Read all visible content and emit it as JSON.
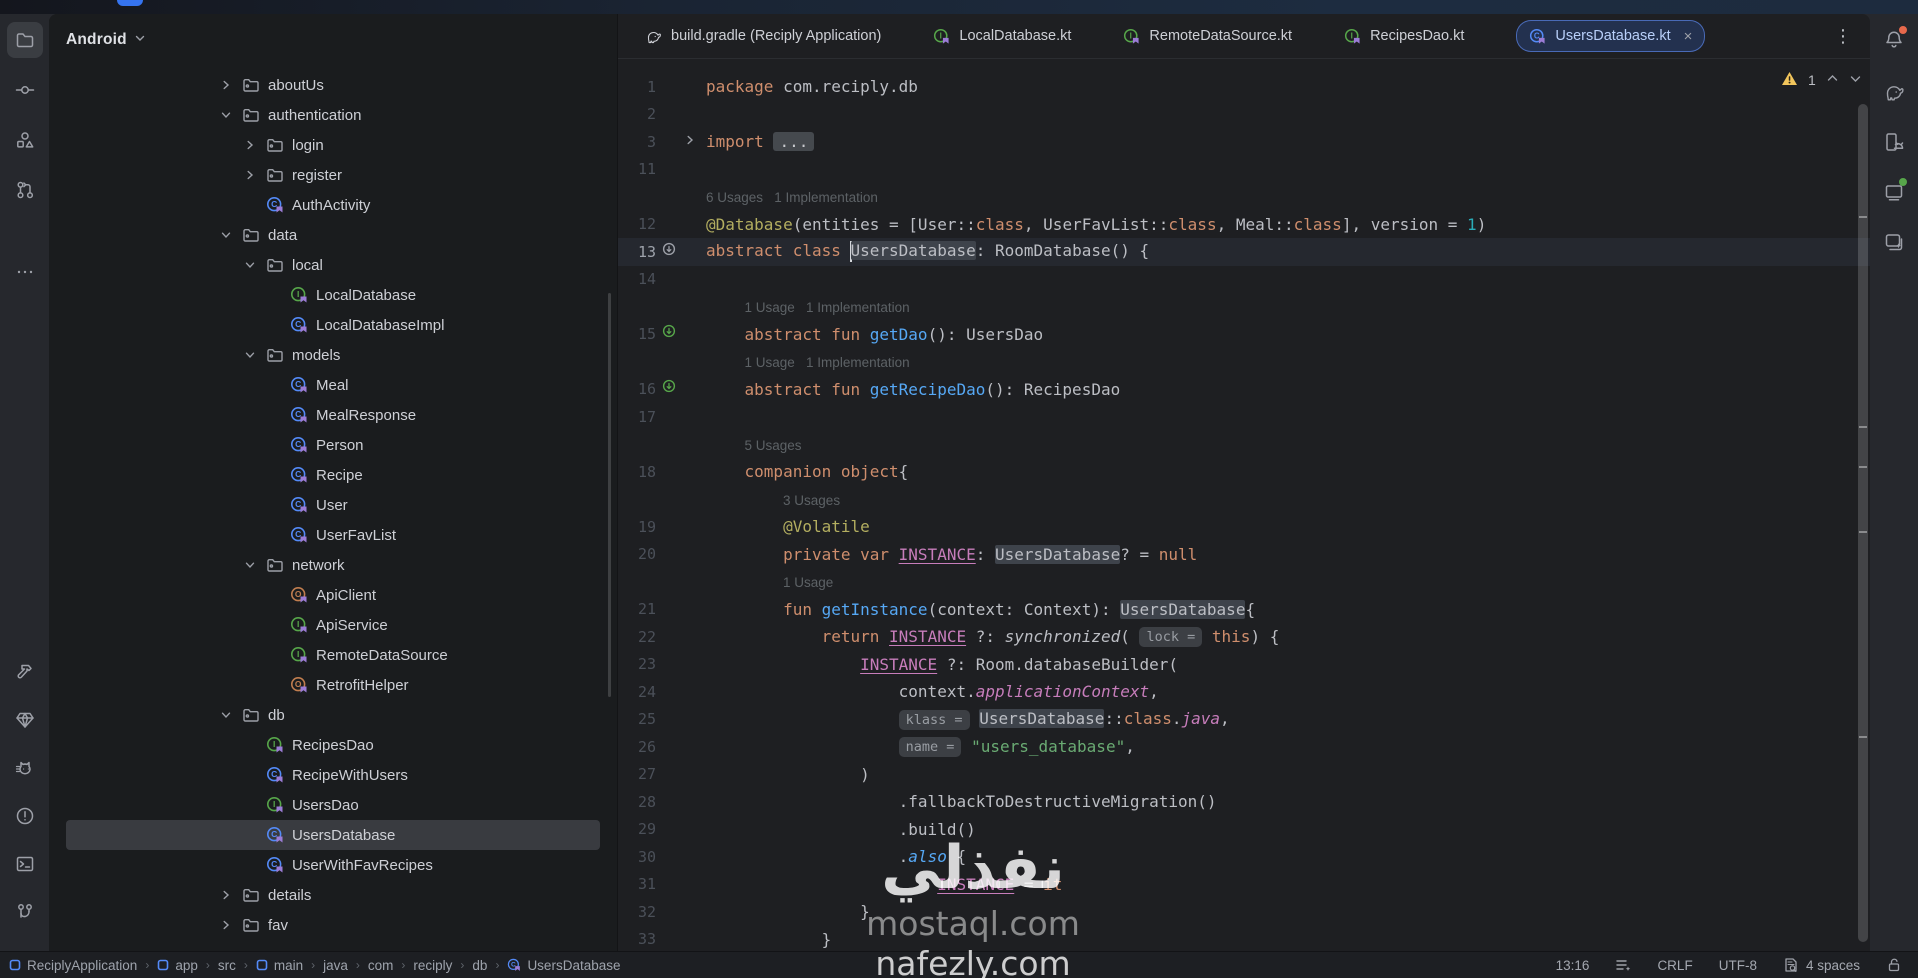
{
  "project_panel": {
    "header": "Android",
    "tree": [
      {
        "label": "aboutUs",
        "kind": "folder",
        "level": 0,
        "chevron": "right"
      },
      {
        "label": "authentication",
        "kind": "folder",
        "level": 0,
        "chevron": "down"
      },
      {
        "label": "login",
        "kind": "folder",
        "level": 1,
        "chevron": "right"
      },
      {
        "label": "register",
        "kind": "folder",
        "level": 1,
        "chevron": "right"
      },
      {
        "label": "AuthActivity",
        "kind": "class",
        "level": 1
      },
      {
        "label": "data",
        "kind": "folder",
        "level": 0,
        "chevron": "down"
      },
      {
        "label": "local",
        "kind": "folder",
        "level": 1,
        "chevron": "down"
      },
      {
        "label": "LocalDatabase",
        "kind": "interface",
        "level": 2
      },
      {
        "label": "LocalDatabaseImpl",
        "kind": "class",
        "level": 2
      },
      {
        "label": "models",
        "kind": "folder",
        "level": 1,
        "chevron": "down"
      },
      {
        "label": "Meal",
        "kind": "class",
        "level": 2
      },
      {
        "label": "MealResponse",
        "kind": "class",
        "level": 2
      },
      {
        "label": "Person",
        "kind": "class",
        "level": 2
      },
      {
        "label": "Recipe",
        "kind": "class",
        "level": 2
      },
      {
        "label": "User",
        "kind": "class",
        "level": 2
      },
      {
        "label": "UserFavList",
        "kind": "class",
        "level": 2
      },
      {
        "label": "network",
        "kind": "folder",
        "level": 1,
        "chevron": "down"
      },
      {
        "label": "ApiClient",
        "kind": "object",
        "level": 2
      },
      {
        "label": "ApiService",
        "kind": "interface",
        "level": 2
      },
      {
        "label": "RemoteDataSource",
        "kind": "interface",
        "level": 2
      },
      {
        "label": "RetrofitHelper",
        "kind": "object",
        "level": 2
      },
      {
        "label": "db",
        "kind": "folder",
        "level": 0,
        "chevron": "down"
      },
      {
        "label": "RecipesDao",
        "kind": "interface",
        "level": 1
      },
      {
        "label": "RecipeWithUsers",
        "kind": "class",
        "level": 1
      },
      {
        "label": "UsersDao",
        "kind": "interface",
        "level": 1
      },
      {
        "label": "UsersDatabase",
        "kind": "class",
        "level": 1,
        "selected": true
      },
      {
        "label": "UserWithFavRecipes",
        "kind": "class",
        "level": 1
      },
      {
        "label": "details",
        "kind": "folder",
        "level": 0,
        "chevron": "right"
      },
      {
        "label": "fav",
        "kind": "folder",
        "level": 0,
        "chevron": "right"
      }
    ]
  },
  "left_stripe": {
    "top": [
      {
        "name": "project",
        "icon": "folder-tool",
        "active": true
      },
      {
        "name": "commit",
        "icon": "commit"
      },
      {
        "name": "resource-manager",
        "icon": "resource-manager"
      },
      {
        "name": "pull-requests",
        "icon": "pull-requests"
      },
      {
        "name": "more-tool-windows",
        "icon": "more"
      }
    ],
    "bottom": [
      {
        "name": "build",
        "icon": "hammer"
      },
      {
        "name": "app-quality-insights",
        "icon": "diamond"
      },
      {
        "name": "profiler",
        "icon": "profiler-cat"
      },
      {
        "name": "problems",
        "icon": "problems"
      },
      {
        "name": "terminal",
        "icon": "terminal"
      },
      {
        "name": "version-control",
        "icon": "git-branch"
      }
    ]
  },
  "right_stripe": [
    {
      "name": "notifications",
      "icon": "bell",
      "badge": "#E8694C"
    },
    {
      "name": "gradle",
      "icon": "gradle"
    },
    {
      "name": "device-manager",
      "icon": "device-manager"
    },
    {
      "name": "running-devices",
      "icon": "running-devices",
      "badge": "#57A64A"
    },
    {
      "name": "gemini",
      "icon": "gemini"
    }
  ],
  "tabs": {
    "items": [
      {
        "label": "build.gradle (Reciply Application)",
        "icon": "gradle"
      },
      {
        "label": "LocalDatabase.kt",
        "icon": "interface"
      },
      {
        "label": "RemoteDataSource.kt",
        "icon": "interface"
      },
      {
        "label": "RecipesDao.kt",
        "icon": "interface"
      },
      {
        "label": "UsersDatabase.kt",
        "icon": "class",
        "active": true,
        "close": "×"
      }
    ]
  },
  "editor": {
    "inspection": {
      "warning_count": "1"
    },
    "rows": [
      {
        "n": "1",
        "segs": [
          [
            "kw",
            "package "
          ],
          [
            "pl",
            "com.reciply.db"
          ]
        ]
      },
      {
        "n": "2",
        "segs": []
      },
      {
        "n": "3",
        "fold": true,
        "segs": [
          [
            "kw",
            "import "
          ],
          [
            "folded",
            "..."
          ]
        ]
      },
      {
        "n": "11",
        "segs": []
      },
      {
        "inlay": "6 Usages   1 Implementation",
        "ind": 0
      },
      {
        "n": "12",
        "segs": [
          [
            "ann",
            "@Database"
          ],
          [
            "pl",
            "(entities = [User::"
          ],
          [
            "kw",
            "class"
          ],
          [
            "pl",
            ", UserFavList::"
          ],
          [
            "kw",
            "class"
          ],
          [
            "pl",
            ", Meal::"
          ],
          [
            "kw",
            "class"
          ],
          [
            "pl",
            "], version = "
          ],
          [
            "num",
            "1"
          ],
          [
            "pl",
            ")"
          ]
        ]
      },
      {
        "n": "13",
        "cur": true,
        "g": "gray",
        "segs": [
          [
            "kw",
            "abstract class "
          ],
          [
            "caret",
            ""
          ],
          [
            "pl hl",
            "UsersDatabase"
          ],
          [
            "pl",
            ": RoomDatabase() {"
          ]
        ]
      },
      {
        "n": "14",
        "segs": []
      },
      {
        "inlay": "1 Usage   1 Implementation",
        "ind": 4
      },
      {
        "n": "15",
        "g": "green",
        "segs": [
          [
            "pl",
            "    "
          ],
          [
            "kw",
            "abstract fun "
          ],
          [
            "fn",
            "getDao"
          ],
          [
            "pl",
            "(): UsersDao"
          ]
        ]
      },
      {
        "inlay": "1 Usage   1 Implementation",
        "ind": 4
      },
      {
        "n": "16",
        "g": "green",
        "segs": [
          [
            "pl",
            "    "
          ],
          [
            "kw",
            "abstract fun "
          ],
          [
            "fn",
            "getRecipeDao"
          ],
          [
            "pl",
            "(): RecipesDao"
          ]
        ]
      },
      {
        "n": "17",
        "segs": []
      },
      {
        "inlay": "5 Usages",
        "ind": 4
      },
      {
        "n": "18",
        "segs": [
          [
            "pl",
            "    "
          ],
          [
            "kw",
            "companion object"
          ],
          [
            "pl",
            "{"
          ]
        ]
      },
      {
        "inlay": "3 Usages",
        "ind": 8
      },
      {
        "n": "19",
        "segs": [
          [
            "pl",
            "        "
          ],
          [
            "ann",
            "@Volatile"
          ]
        ]
      },
      {
        "n": "20",
        "segs": [
          [
            "pl",
            "        "
          ],
          [
            "kw",
            "private var "
          ],
          [
            "field",
            "INSTANCE"
          ],
          [
            "pl",
            ": "
          ],
          [
            "pl hl",
            "UsersDatabase"
          ],
          [
            "pl",
            "? = "
          ],
          [
            "kw",
            "null"
          ]
        ]
      },
      {
        "inlay": "1 Usage",
        "ind": 8
      },
      {
        "n": "21",
        "segs": [
          [
            "pl",
            "        "
          ],
          [
            "kw",
            "fun "
          ],
          [
            "fn",
            "getInstance"
          ],
          [
            "pl",
            "(context: Context): "
          ],
          [
            "pl hl",
            "UsersDatabase"
          ],
          [
            "pl",
            "{"
          ]
        ]
      },
      {
        "n": "22",
        "segs": [
          [
            "pl",
            "            "
          ],
          [
            "kw",
            "return "
          ],
          [
            "field",
            "INSTANCE"
          ],
          [
            "pl",
            " ?: "
          ],
          [
            "syn",
            "synchronized"
          ],
          [
            "pl",
            "( "
          ],
          [
            "chip",
            "lock ="
          ],
          [
            "pl",
            " "
          ],
          [
            "kw",
            "this"
          ],
          [
            "pl",
            ") {"
          ]
        ]
      },
      {
        "n": "23",
        "segs": [
          [
            "pl",
            "                "
          ],
          [
            "field",
            "INSTANCE"
          ],
          [
            "pl",
            " ?: Room.databaseBuilder("
          ]
        ]
      },
      {
        "n": "24",
        "segs": [
          [
            "pl",
            "                    context."
          ],
          [
            "prop",
            "applicationContext"
          ],
          [
            "pl",
            ","
          ]
        ]
      },
      {
        "n": "25",
        "segs": [
          [
            "pl",
            "                    "
          ],
          [
            "chip",
            "klass ="
          ],
          [
            "pl",
            " "
          ],
          [
            "pl hl",
            "UsersDatabase"
          ],
          [
            "pl",
            "::"
          ],
          [
            "kw",
            "class"
          ],
          [
            "pl",
            "."
          ],
          [
            "prop",
            "java"
          ],
          [
            "pl",
            ","
          ]
        ]
      },
      {
        "n": "26",
        "segs": [
          [
            "pl",
            "                    "
          ],
          [
            "chip",
            "name ="
          ],
          [
            "pl",
            " "
          ],
          [
            "str",
            "\"users_database\""
          ],
          [
            "pl",
            ","
          ]
        ]
      },
      {
        "n": "27",
        "segs": [
          [
            "pl",
            "                )"
          ]
        ]
      },
      {
        "n": "28",
        "segs": [
          [
            "pl",
            "                    .fallbackToDestructiveMigration()"
          ]
        ]
      },
      {
        "n": "29",
        "segs": [
          [
            "pl",
            "                    .build()"
          ]
        ]
      },
      {
        "n": "30",
        "segs": [
          [
            "pl",
            "                    ."
          ],
          [
            "itfn",
            "also"
          ],
          [
            "pl",
            " {"
          ]
        ]
      },
      {
        "n": "31",
        "segs": [
          [
            "pl",
            "                        "
          ],
          [
            "field",
            "INSTANCE"
          ],
          [
            "pl",
            " = "
          ],
          [
            "kw",
            "it"
          ]
        ]
      },
      {
        "n": "32",
        "segs": [
          [
            "pl",
            "                }"
          ]
        ]
      },
      {
        "n": "33",
        "segs": [
          [
            "pl",
            "            }"
          ]
        ]
      }
    ]
  },
  "status_bar": {
    "breadcrumbs": [
      {
        "label": "ReciplyApplication",
        "icon": "module"
      },
      {
        "label": "app",
        "icon": "module"
      },
      {
        "label": "src"
      },
      {
        "label": "main",
        "icon": "module"
      },
      {
        "label": "java"
      },
      {
        "label": "com"
      },
      {
        "label": "reciply"
      },
      {
        "label": "db"
      },
      {
        "label": "UsersDatabase",
        "icon": "class"
      }
    ],
    "right_items": [
      {
        "name": "caret-position",
        "label": "13:16"
      },
      {
        "name": "indent-options",
        "icon": "indent-options"
      },
      {
        "name": "line-separator",
        "label": "CRLF"
      },
      {
        "name": "file-encoding",
        "label": "UTF-8"
      },
      {
        "name": "indent-size",
        "icon": "inspect-file",
        "label": "4 spaces"
      },
      {
        "name": "write-access",
        "icon": "lock-open"
      }
    ]
  },
  "watermark": {
    "line1": "نفذلي",
    "line2": "mostaql.com",
    "line3": "nafezly.com"
  },
  "colors": {
    "accent": "#3574F0",
    "warning": "#F2C55C",
    "keyword": "#CF8E6D",
    "function": "#56A8F5",
    "annotation": "#B3AE60",
    "string": "#6AAB73",
    "number": "#2AACB8",
    "property": "#C77DBB",
    "class_icon": "#548AF7",
    "interface_icon": "#57A64A",
    "object_icon": "#C07D4F",
    "notification_badge": "#E8694C",
    "running_badge": "#57A64A"
  }
}
